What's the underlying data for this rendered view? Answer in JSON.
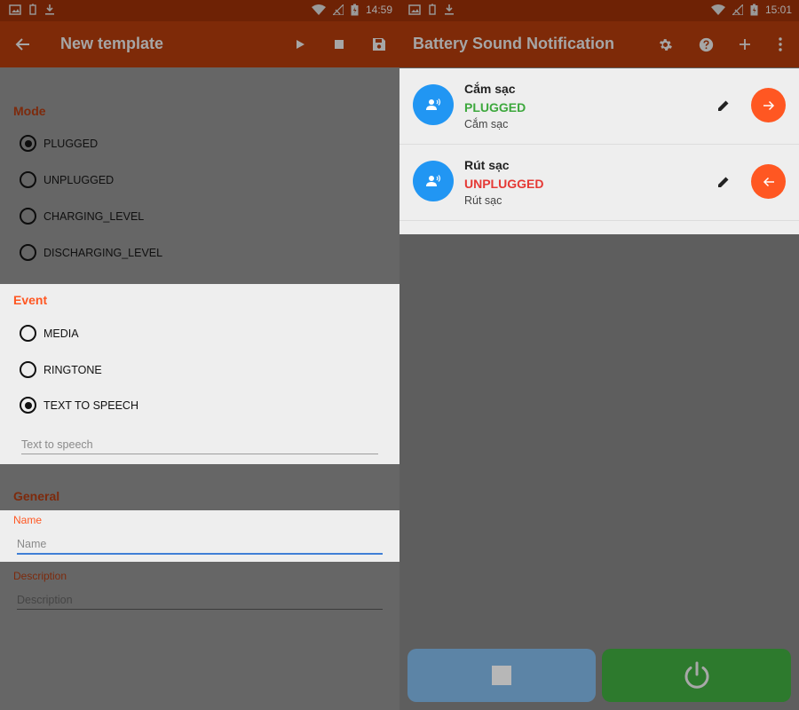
{
  "left": {
    "status": {
      "time": "14:59"
    },
    "appbar": {
      "title": "New template"
    },
    "mode": {
      "title": "Mode",
      "options": [
        {
          "label": "PLUGGED",
          "selected": true
        },
        {
          "label": "UNPLUGGED",
          "selected": false
        },
        {
          "label": "CHARGING_LEVEL",
          "selected": false
        },
        {
          "label": "DISCHARGING_LEVEL",
          "selected": false
        }
      ]
    },
    "event": {
      "title": "Event",
      "options": [
        {
          "label": "MEDIA",
          "selected": false
        },
        {
          "label": "RINGTONE",
          "selected": false
        },
        {
          "label": "TEXT TO SPEECH",
          "selected": true
        }
      ],
      "tts_placeholder": "Text to speech"
    },
    "general": {
      "title": "General",
      "name_label": "Name",
      "name_placeholder": "Name",
      "description_label": "Description",
      "description_placeholder": "Description"
    }
  },
  "right": {
    "status": {
      "time": "15:01"
    },
    "appbar": {
      "title": "Battery Sound Notification"
    },
    "items": [
      {
        "title": "Cắm sạc",
        "status": "PLUGGED",
        "status_color": "#3da83d",
        "subtitle": "Cắm sạc",
        "action_icon": "arrow-right-icon"
      },
      {
        "title": "Rút sạc",
        "status": "UNPLUGGED",
        "status_color": "#e53935",
        "subtitle": "Rút sạc",
        "action_icon": "arrow-left-icon"
      }
    ],
    "buttons": {
      "stop_color": "#5c84a6",
      "power_color": "#2d7a2d"
    }
  },
  "colors": {
    "accent": "#ff5722",
    "appbar": "#7e2a08",
    "statusbar": "#6e2205",
    "dim_accent": "#7d2a0c"
  }
}
